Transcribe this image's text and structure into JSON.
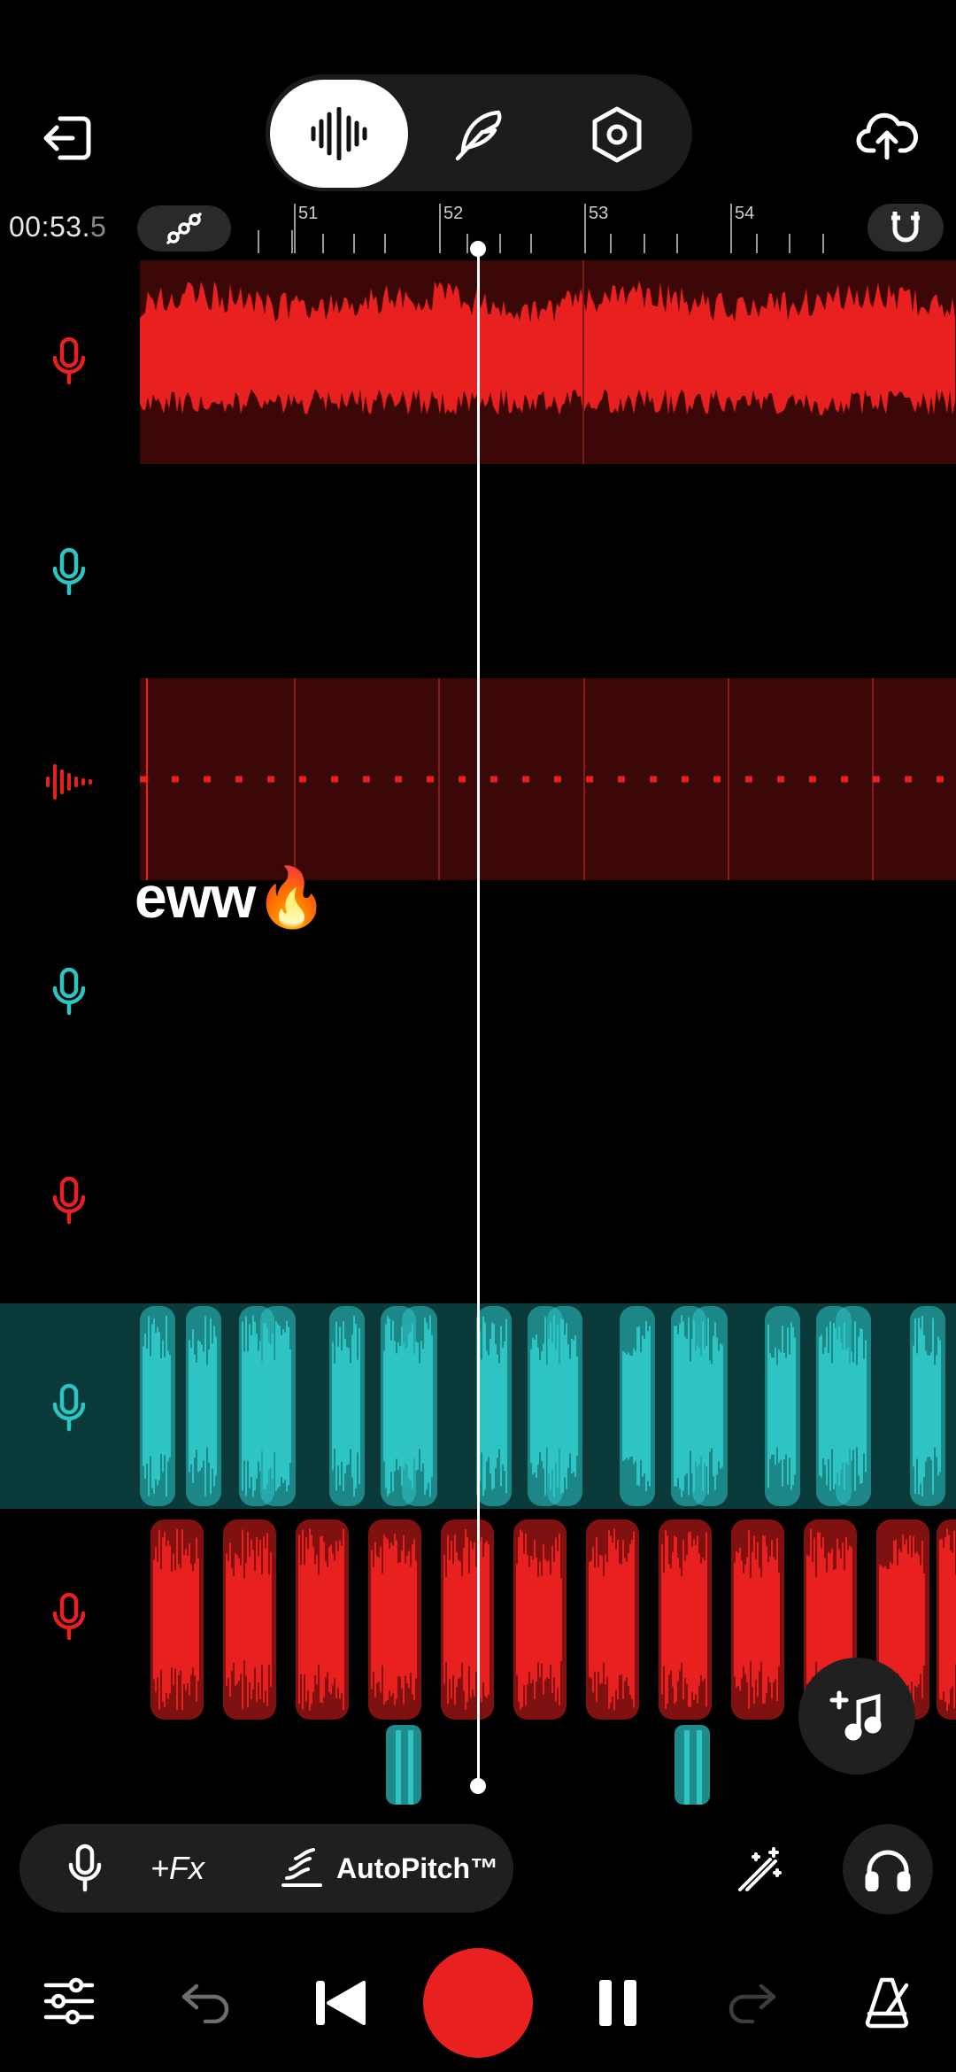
{
  "header": {
    "time": {
      "main": "00:53.",
      "fraction": "5"
    },
    "ruler": [
      "51",
      "52",
      "53",
      "54"
    ]
  },
  "sticker": {
    "text": "eww",
    "emoji": "🔥"
  },
  "toolbar": {
    "fx_label": "+Fx",
    "autopitch_label": "AutoPitch™"
  },
  "icons": {
    "exit": "exit-icon",
    "waveform_tab": "waveform-icon",
    "feather_tab": "feather-icon",
    "settings_tab": "hex-settings-icon",
    "upload": "cloud-upload-icon",
    "automation": "automation-icon",
    "magnet": "magnet-icon",
    "mic": "mic-icon",
    "beat": "beat-waveform-icon",
    "add_note": "add-note-icon",
    "wand": "wand-icon",
    "headphones": "headphones-icon",
    "mixer": "mixer-sliders-icon",
    "undo": "undo-icon",
    "rewind": "skip-back-icon",
    "record": "record-icon",
    "pause": "pause-icon",
    "redo": "redo-icon",
    "metronome": "metronome-icon"
  },
  "colors": {
    "red": "#e8201f",
    "teal": "#2ec4c4",
    "dark_red": "#3c0807",
    "dark_teal": "#0b3a3a"
  }
}
